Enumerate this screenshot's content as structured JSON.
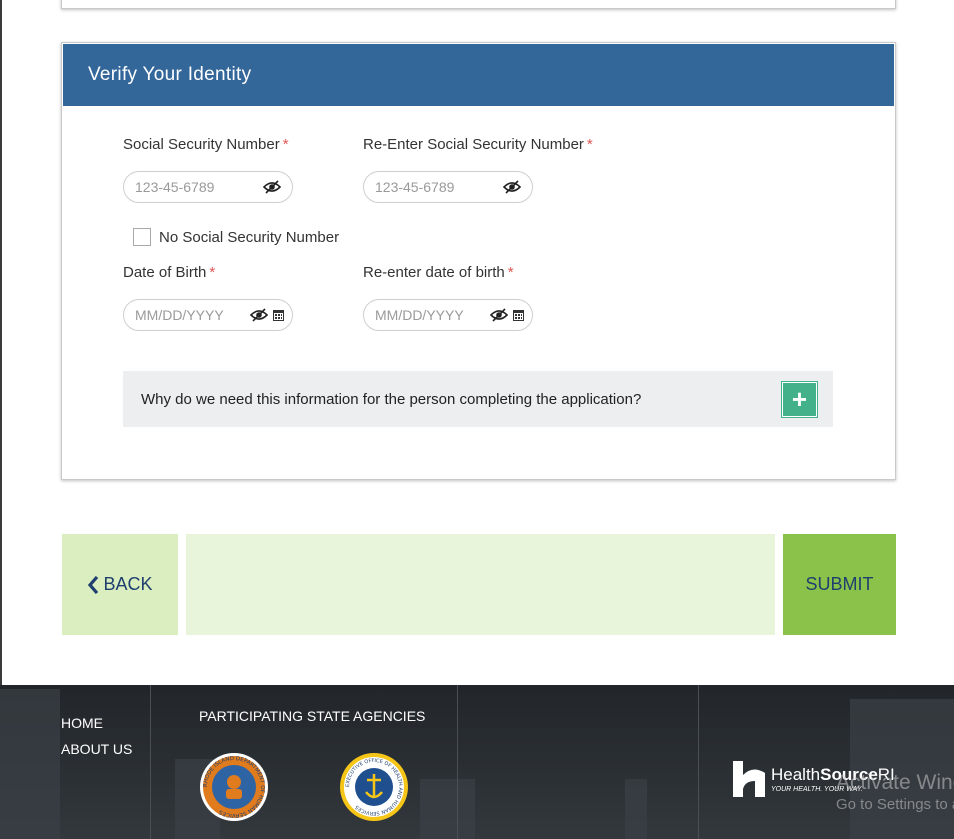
{
  "identity_card": {
    "title": "Verify Your Identity",
    "ssn": {
      "label": "Social Security Number",
      "placeholder": "123-45-6789",
      "required_mark": "*"
    },
    "ssn_confirm": {
      "label": "Re-Enter Social Security Number",
      "placeholder": "123-45-6789",
      "required_mark": "*"
    },
    "no_ssn": {
      "label": "No Social Security Number",
      "checked": false
    },
    "dob": {
      "label": "Date of Birth",
      "placeholder": "MM/DD/YYYY",
      "required_mark": "*"
    },
    "dob_confirm": {
      "label": "Re-enter date of birth",
      "placeholder": "MM/DD/YYYY",
      "required_mark": "*"
    },
    "info": {
      "question": "Why do we need this information for the person completing the application?",
      "expand_symbol": "+"
    }
  },
  "navigation": {
    "back_label": "BACK",
    "submit_label": "SUBMIT"
  },
  "footer": {
    "links": [
      "HOME",
      "ABOUT US"
    ],
    "agencies_title": "PARTICIPATING STATE AGENCIES",
    "seal_1_text": "RHODE ISLAND DEPARTMENT OF HUMAN SERVICES",
    "seal_2_text": "EXECUTIVE OFFICE OF HEALTH AND HUMAN SERVICES",
    "logo_name_a": "Health",
    "logo_name_b": "Source",
    "logo_name_c": "RI",
    "logo_tagline": "YOUR HEALTH. YOUR WAY."
  },
  "watermark": {
    "line1": "Activate Windows",
    "line2": "Go to Settings to activate Windows."
  },
  "colors": {
    "header": "#336699",
    "required": "#e05555",
    "submit": "#8bc34a",
    "back": "#daeebf",
    "plus": "#43b28a"
  }
}
